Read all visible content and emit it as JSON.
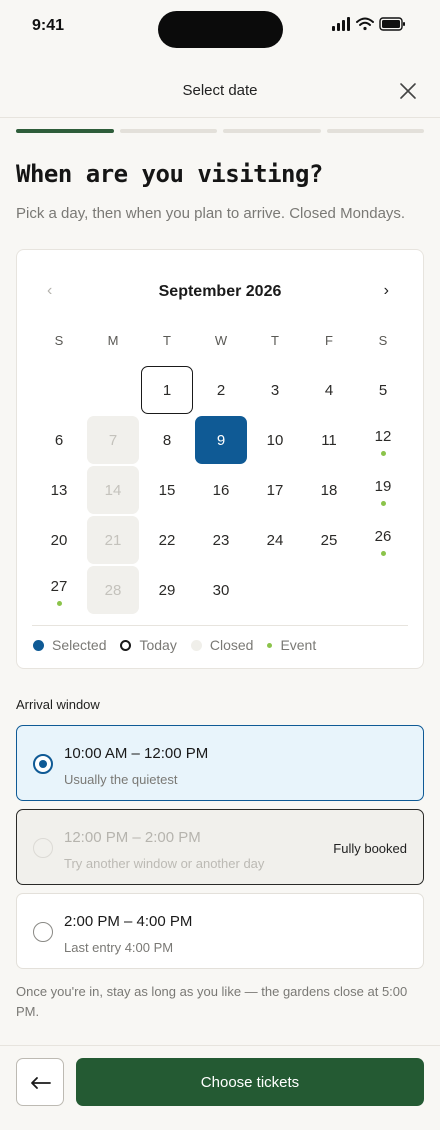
{
  "status_bar": {
    "time": "9:41"
  },
  "header": {
    "title": "Select date",
    "close_icon": "close-icon"
  },
  "progress": {
    "steps_total": 4,
    "current_step": 1
  },
  "page": {
    "title": "When are you visiting?",
    "subtitle": "Pick a day, then when you plan to arrive. Closed Mondays."
  },
  "calendar": {
    "month_label": "September 2026",
    "prev_label": "‹",
    "next_label": "›",
    "weekdays": [
      "S",
      "M",
      "T",
      "W",
      "T",
      "F",
      "S"
    ],
    "leading_blanks": 2,
    "days": [
      {
        "n": "1",
        "state": "today"
      },
      {
        "n": "2",
        "state": ""
      },
      {
        "n": "3",
        "state": ""
      },
      {
        "n": "4",
        "state": ""
      },
      {
        "n": "5",
        "state": ""
      },
      {
        "n": "6",
        "state": ""
      },
      {
        "n": "7",
        "state": "closed"
      },
      {
        "n": "8",
        "state": ""
      },
      {
        "n": "9",
        "state": "selected"
      },
      {
        "n": "10",
        "state": ""
      },
      {
        "n": "11",
        "state": ""
      },
      {
        "n": "12",
        "state": "event"
      },
      {
        "n": "13",
        "state": ""
      },
      {
        "n": "14",
        "state": "closed"
      },
      {
        "n": "15",
        "state": ""
      },
      {
        "n": "16",
        "state": ""
      },
      {
        "n": "17",
        "state": ""
      },
      {
        "n": "18",
        "state": ""
      },
      {
        "n": "19",
        "state": "event"
      },
      {
        "n": "20",
        "state": ""
      },
      {
        "n": "21",
        "state": "closed"
      },
      {
        "n": "22",
        "state": ""
      },
      {
        "n": "23",
        "state": ""
      },
      {
        "n": "24",
        "state": ""
      },
      {
        "n": "25",
        "state": ""
      },
      {
        "n": "26",
        "state": "event"
      },
      {
        "n": "27",
        "state": "event"
      },
      {
        "n": "28",
        "state": "closed"
      },
      {
        "n": "29",
        "state": ""
      },
      {
        "n": "30",
        "state": ""
      }
    ],
    "legend": {
      "selected": "Selected",
      "today": "Today",
      "closed": "Closed",
      "event": "Event"
    }
  },
  "arrival": {
    "label": "Arrival window",
    "slots": [
      {
        "time": "10:00 AM – 12:00 PM",
        "note": "Usually the quietest",
        "badge": ""
      },
      {
        "time": "12:00 PM – 2:00 PM",
        "note": "Try another window or another day",
        "badge": "Fully booked"
      },
      {
        "time": "2:00 PM – 4:00 PM",
        "note": "Last entry 4:00 PM",
        "badge": ""
      }
    ]
  },
  "footnote": "Once you're in, stay as long as you like — the gardens close at 5:00 PM.",
  "footer": {
    "back_icon": "arrow-left-icon",
    "primary_label": "Choose tickets"
  },
  "colors": {
    "accent_green": "#245a33",
    "selected_blue": "#0f5a95",
    "event_green": "#8bc34a",
    "background": "#f8f7f4"
  }
}
